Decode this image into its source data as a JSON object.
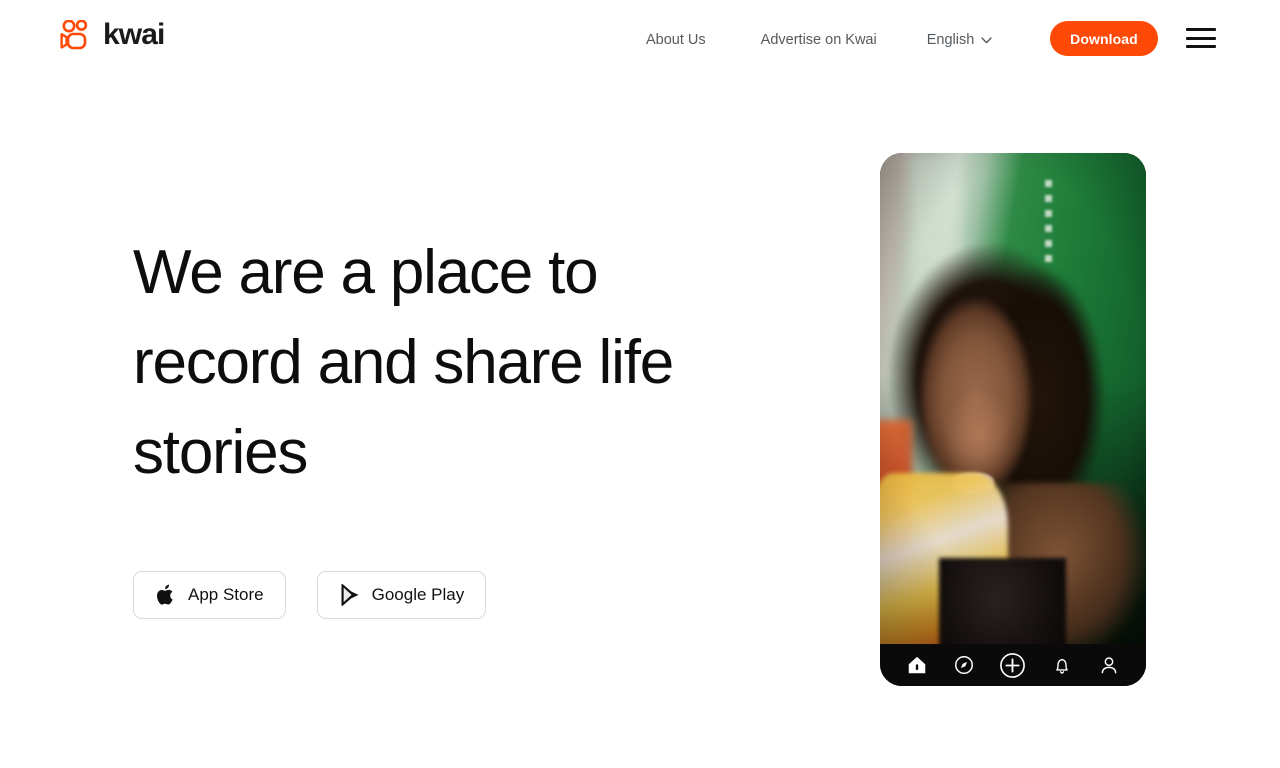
{
  "brand": {
    "name": "kwai",
    "logo_icon": "kwai-camera-icon",
    "accent_color": "#ff4906"
  },
  "header": {
    "nav": [
      {
        "label": "About Us",
        "name": "about-us"
      },
      {
        "label": "Advertise on Kwai",
        "name": "advertise-on-kwai"
      }
    ],
    "language": {
      "label": "English",
      "chevron_icon": "chevron-down-icon"
    },
    "download_button": {
      "label": "Download",
      "background": "#ff4906",
      "text_color": "#ffffff"
    },
    "menu_icon": "hamburger-menu-icon"
  },
  "hero": {
    "title": "We are a place to record and share life stories",
    "store_buttons": [
      {
        "label": "App Store",
        "icon": "apple-logo-icon"
      },
      {
        "label": "Google Play",
        "icon": "google-play-icon"
      }
    ]
  },
  "phone_preview": {
    "media_description": "Smiling woman with curly hair in front of a green wall",
    "tabbar": [
      {
        "name": "home",
        "icon": "home-icon",
        "active": true
      },
      {
        "name": "discover",
        "icon": "compass-icon",
        "active": false
      },
      {
        "name": "create",
        "icon": "plus-circle-icon",
        "active": false
      },
      {
        "name": "notifications",
        "icon": "bell-icon",
        "active": false
      },
      {
        "name": "profile",
        "icon": "user-icon",
        "active": false
      }
    ]
  }
}
